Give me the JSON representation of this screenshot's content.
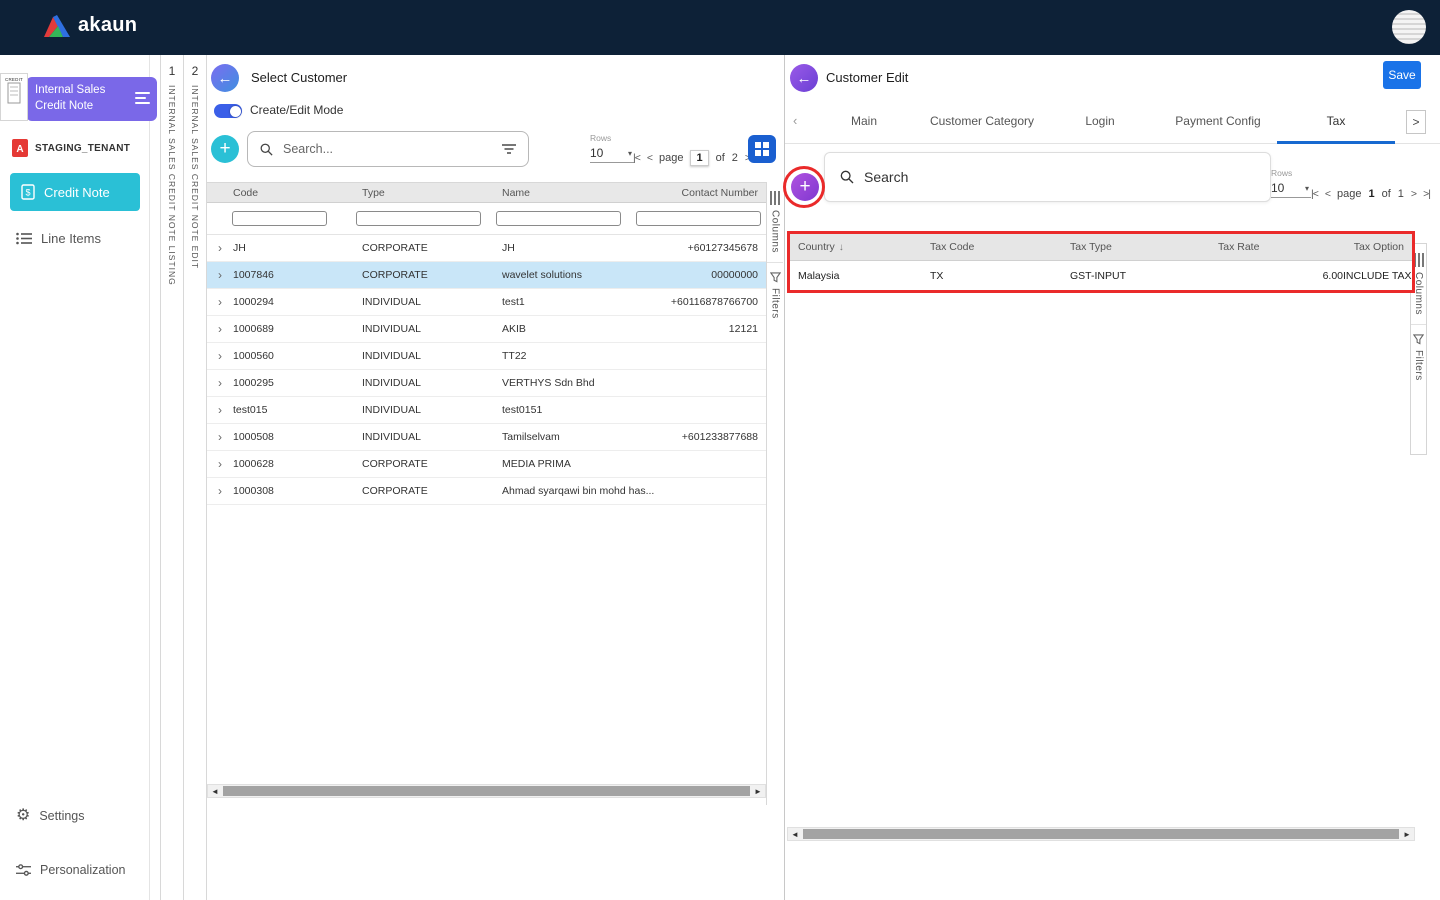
{
  "topbar": {
    "brand": "akaun"
  },
  "sidebar": {
    "module_label": "Internal Sales Credit Note",
    "module_icon_caption": "CREDIT",
    "tenant": "STAGING_TENANT",
    "items": [
      {
        "label": "Credit Note"
      },
      {
        "label": "Line Items"
      }
    ],
    "footer": [
      {
        "label": "Settings"
      },
      {
        "label": "Personalization"
      }
    ]
  },
  "strips": [
    {
      "num": "1",
      "label": "INTERNAL SALES CREDIT NOTE LISTING"
    },
    {
      "num": "2",
      "label": "INTERNAL SALES CREDIT NOTE EDIT"
    }
  ],
  "side_tabs": {
    "columns_label": "Columns",
    "filters_label": "Filters"
  },
  "customer_panel": {
    "title": "Select Customer",
    "toggle_label": "Create/Edit Mode",
    "search_placeholder": "Search...",
    "rows_label": "Rows",
    "rows_value": "10",
    "pagination": {
      "page_label": "page",
      "current": "1",
      "of_label": "of",
      "total": "2"
    },
    "table": {
      "columns": [
        "Code",
        "Type",
        "Name",
        "Contact Number"
      ],
      "rows": [
        {
          "code": "JH",
          "type": "CORPORATE",
          "name": "JH",
          "contact": "+60127345678"
        },
        {
          "code": "1007846",
          "type": "CORPORATE",
          "name": "wavelet solutions",
          "contact": "00000000",
          "selected": true
        },
        {
          "code": "1000294",
          "type": "INDIVIDUAL",
          "name": "test1",
          "contact": "+60116878766700"
        },
        {
          "code": "1000689",
          "type": "INDIVIDUAL",
          "name": "AKIB",
          "contact": "12121"
        },
        {
          "code": "1000560",
          "type": "INDIVIDUAL",
          "name": "TT22",
          "contact": ""
        },
        {
          "code": "1000295",
          "type": "INDIVIDUAL",
          "name": "VERTHYS Sdn Bhd",
          "contact": ""
        },
        {
          "code": "test015",
          "type": "INDIVIDUAL",
          "name": "test0151",
          "contact": ""
        },
        {
          "code": "1000508",
          "type": "INDIVIDUAL",
          "name": "Tamilselvam",
          "contact": "+601233877688"
        },
        {
          "code": "1000628",
          "type": "CORPORATE",
          "name": "MEDIA PRIMA",
          "contact": ""
        },
        {
          "code": "1000308",
          "type": "CORPORATE",
          "name": "Ahmad syarqawi bin mohd has...",
          "contact": ""
        }
      ]
    }
  },
  "edit_panel": {
    "title": "Customer Edit",
    "save_label": "Save",
    "tabs": [
      {
        "label": "Main"
      },
      {
        "label": "Customer Category"
      },
      {
        "label": "Login"
      },
      {
        "label": "Payment Config"
      },
      {
        "label": "Tax",
        "active": true
      }
    ],
    "search_placeholder": "Search",
    "rows_label": "Rows",
    "rows_value": "10",
    "pagination": {
      "page_label": "page",
      "current": "1",
      "of_label": "of",
      "total": "1"
    },
    "table": {
      "columns": [
        "Country",
        "Tax Code",
        "Tax Type",
        "Tax Rate",
        "Tax Option"
      ],
      "rows": [
        {
          "country": "Malaysia",
          "tax_code": "TX",
          "tax_type": "GST-INPUT",
          "tax_rate": "6.00",
          "tax_option": "INCLUDE TAX"
        }
      ]
    }
  },
  "icons": {
    "back": "←",
    "plus": "+",
    "caret_down": "▾",
    "sort_desc": "↓",
    "pg_first": "|<",
    "pg_prev": "<",
    "pg_next": ">",
    "pg_last": ">|",
    "scroll_left": "◄",
    "scroll_right": "►",
    "gear": "⚙",
    "chev_left": "‹",
    "chev_right": ">",
    "row_chevron": "›"
  },
  "colors": {
    "topbar_bg": "#0d2137",
    "module_purple": "#7a68e8",
    "accent_cyan": "#2ac0d6",
    "save_blue": "#1a73e8",
    "tab_underline_blue": "#1769d0",
    "selected_row_blue": "#c9e6f8",
    "annotation_red": "#ea2a2a"
  }
}
